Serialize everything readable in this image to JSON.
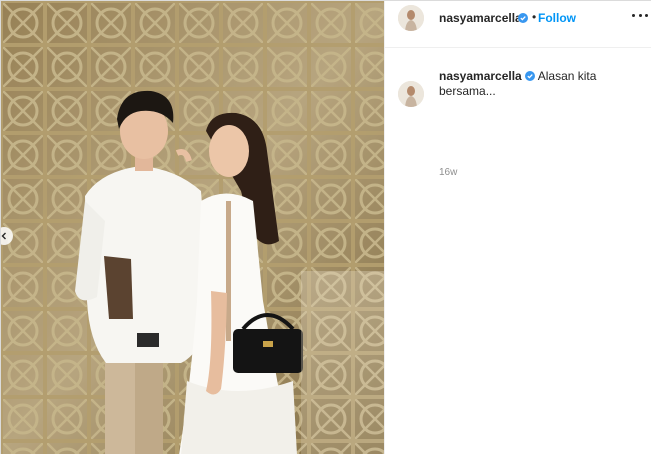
{
  "post": {
    "username": "nasyamarcella",
    "verified": true,
    "follow_label": "Follow",
    "separator": "•",
    "caption": {
      "username": "nasyamarcella",
      "text": "Alasan kita bersama...",
      "timestamp": "16w"
    }
  },
  "icons": {
    "verified": "verified-badge-icon",
    "more": "more-options-icon",
    "carousel_prev": "chevron-left-icon"
  },
  "colors": {
    "follow": "#0095f6",
    "verified": "#3897f0",
    "text": "#262626",
    "muted": "#8e8e8e"
  }
}
